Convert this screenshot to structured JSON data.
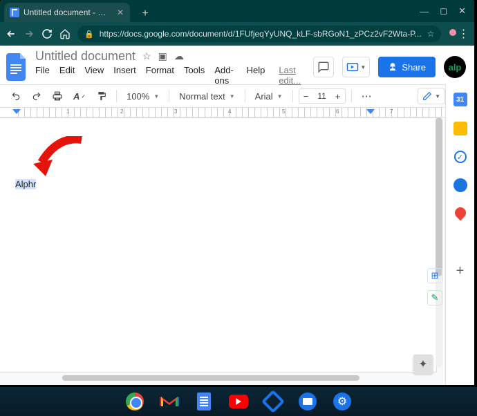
{
  "browser": {
    "tab_title": "Untitled document - Google Doc",
    "url": "https://docs.google.com/document/d/1FUfjeqYyUNQ_kLF-sbRGoN1_zPCz2vF2Wta-P..."
  },
  "header": {
    "title": "Untitled document",
    "last_edit": "Last edit...",
    "share": "Share",
    "avatar": "alp"
  },
  "menus": {
    "file": "File",
    "edit": "Edit",
    "view": "View",
    "insert": "Insert",
    "format": "Format",
    "tools": "Tools",
    "addons": "Add-ons",
    "help": "Help"
  },
  "toolbar": {
    "zoom": "100%",
    "style": "Normal text",
    "font": "Arial",
    "size": "11"
  },
  "ruler": {
    "n1": "1",
    "n2": "2",
    "n3": "3",
    "n4": "4",
    "n5": "5",
    "n6": "6",
    "n7": "7"
  },
  "doc": {
    "text": "Alphr"
  },
  "sidepanel": {
    "cal": "31"
  }
}
